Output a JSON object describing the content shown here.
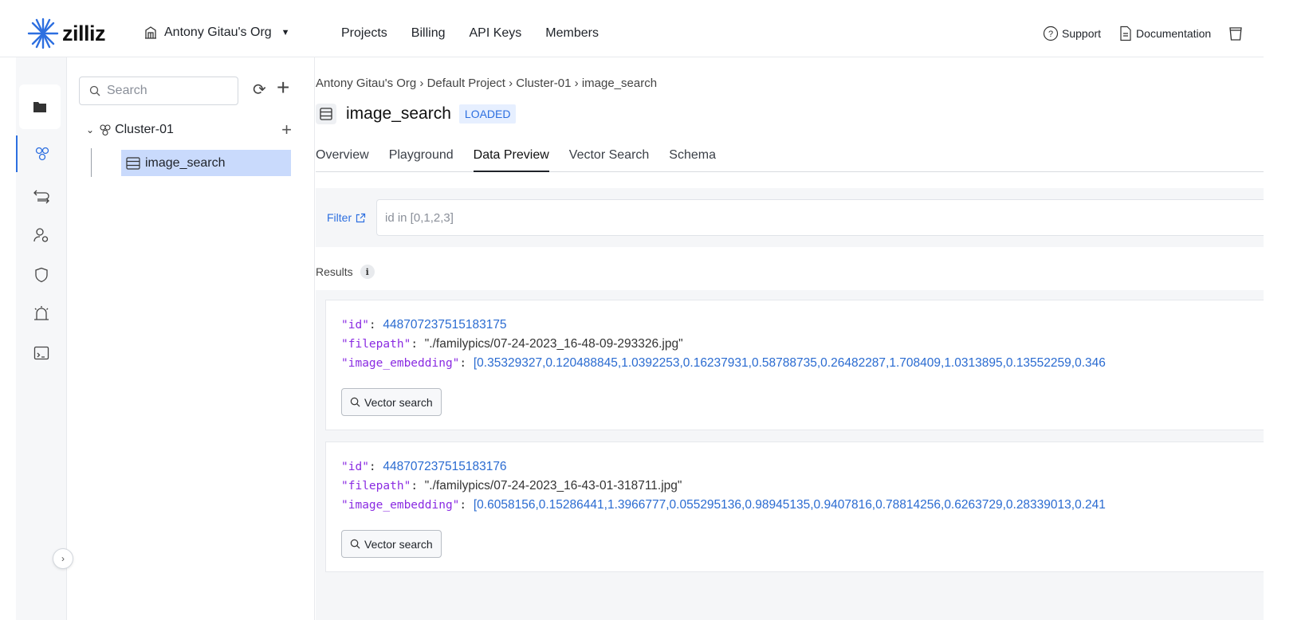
{
  "header": {
    "logo_text": "zilliz",
    "org_name": "Antony Gitau's Org",
    "nav": [
      "Projects",
      "Billing",
      "API Keys",
      "Members"
    ],
    "support_label": "Support",
    "docs_label": "Documentation"
  },
  "tree": {
    "search_placeholder": "Search",
    "cluster_name": "Cluster-01",
    "collection_name": "image_search"
  },
  "main": {
    "breadcrumb": "Antony Gitau's Org › Default Project › Cluster-01 › image_search",
    "title": "image_search",
    "status": "LOADED",
    "tabs": [
      "Overview",
      "Playground",
      "Data Preview",
      "Vector Search",
      "Schema"
    ],
    "active_tab": "Data Preview",
    "filter_label": "Filter",
    "filter_placeholder": "id in [0,1,2,3]",
    "results_label": "Results",
    "info_glyph": "i",
    "vector_search_label": "Vector search",
    "results": [
      {
        "id_key": "\"id\"",
        "id": "448707237515183175",
        "filepath_key": "\"filepath\"",
        "filepath": "\"./familypics/07-24-2023_16-48-09-293326.jpg\"",
        "embedding_key": "\"image_embedding\"",
        "embedding": "[0.35329327,0.120488845,1.0392253,0.16237931,0.58788735,0.26482287,1.708409,1.0313895,0.13552259,0.346"
      },
      {
        "id_key": "\"id\"",
        "id": "448707237515183176",
        "filepath_key": "\"filepath\"",
        "filepath": "\"./familypics/07-24-2023_16-43-01-318711.jpg\"",
        "embedding_key": "\"image_embedding\"",
        "embedding": "[0.6058156,0.15286441,1.3966777,0.055295136,0.98945135,0.9407816,0.78814256,0.6263729,0.28339013,0.241"
      }
    ]
  },
  "colors": {
    "accent": "#2d6fe0",
    "selected_bg": "#c9dafc",
    "json_key": "#8a2be2",
    "json_number": "#2a6bd1"
  }
}
